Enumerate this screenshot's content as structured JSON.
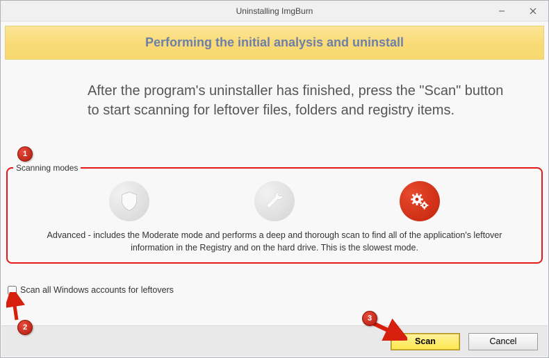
{
  "window": {
    "title": "Uninstalling ImgBurn"
  },
  "banner": {
    "text": "Performing the initial analysis and uninstall"
  },
  "instruction": "After the program's uninstaller has finished, press the \"Scan\" button to start scanning for leftover files, folders and registry items.",
  "scanning_modes": {
    "legend": "Scanning modes",
    "modes": [
      {
        "name": "safe",
        "icon": "shield-icon",
        "active": false
      },
      {
        "name": "moderate",
        "icon": "wrench-icon",
        "active": false
      },
      {
        "name": "advanced",
        "icon": "gears-icon",
        "active": true
      }
    ],
    "description": "Advanced - includes the Moderate mode and performs a deep and thorough scan to find all of the application's leftover information in the Registry and on the hard drive. This is the slowest mode."
  },
  "checkbox": {
    "label": "Scan all Windows accounts for leftovers",
    "checked": false
  },
  "buttons": {
    "scan": "Scan",
    "cancel": "Cancel"
  },
  "annotations": {
    "badge1": "1",
    "badge2": "2",
    "badge3": "3"
  }
}
